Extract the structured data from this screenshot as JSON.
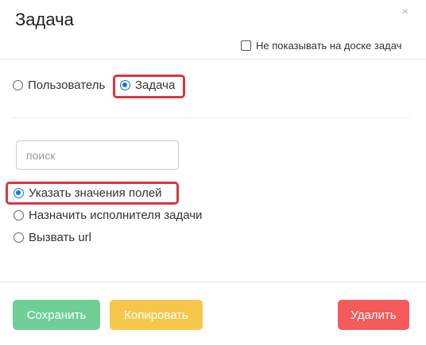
{
  "dialog": {
    "title": "Задача",
    "close_glyph": "×",
    "hide_on_board_label": "Не показывать на доске задач"
  },
  "target_type": {
    "options": [
      {
        "label": "Пользователь",
        "checked": false
      },
      {
        "label": "Задача",
        "checked": true
      }
    ]
  },
  "search": {
    "placeholder": "поиск",
    "value": ""
  },
  "actions": {
    "options": [
      {
        "label": "Указать значения полей",
        "checked": true
      },
      {
        "label": "Назначить исполнителя задачи",
        "checked": false
      },
      {
        "label": "Вызвать url",
        "checked": false
      }
    ]
  },
  "footer": {
    "save_label": "Сохранить",
    "copy_label": "Копировать",
    "delete_label": "Удалить"
  },
  "colors": {
    "radio_checked": "#1a6fe0",
    "highlight": "#d9363e",
    "save": "#6fcf97",
    "copy": "#f5c84c",
    "delete": "#f45b5b"
  }
}
